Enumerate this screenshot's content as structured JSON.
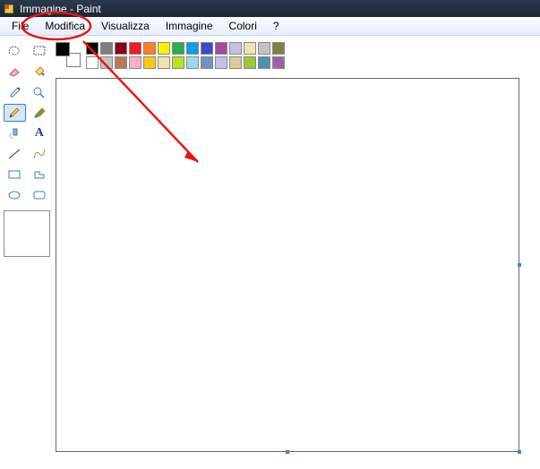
{
  "title": "Immagine - Paint",
  "menus": {
    "file": "File",
    "edit": "Modifica",
    "view": "Visualizza",
    "image": "Immagine",
    "colors": "Colori",
    "help": "?"
  },
  "current_colors": {
    "fg": "#000000",
    "bg": "#ffffff"
  },
  "palette_row1": [
    "#000000",
    "#7f7f7f",
    "#880015",
    "#ed1c24",
    "#ff7f27",
    "#fff200",
    "#22b14c",
    "#00a2e8",
    "#3f48cc",
    "#a349a4",
    "#c8bfe7",
    "#efe4b0",
    "#c3c3c3",
    "#808040"
  ],
  "palette_row2": [
    "#ffffff",
    "#c3c3c3",
    "#b97a57",
    "#ffaec9",
    "#ffc90e",
    "#efe4b0",
    "#b5e61d",
    "#99d9ea",
    "#7092be",
    "#c8bfe7",
    "#e0c89c",
    "#a0c830",
    "#5090b0",
    "#a060a0"
  ],
  "tools": [
    "free-select",
    "rect-select",
    "eraser",
    "fill",
    "pick",
    "magnifier",
    "pencil",
    "brush",
    "airbrush",
    "text",
    "line",
    "curve",
    "rectangle",
    "polygon",
    "ellipse",
    "rounded-rect"
  ],
  "selected_tool": "pencil"
}
